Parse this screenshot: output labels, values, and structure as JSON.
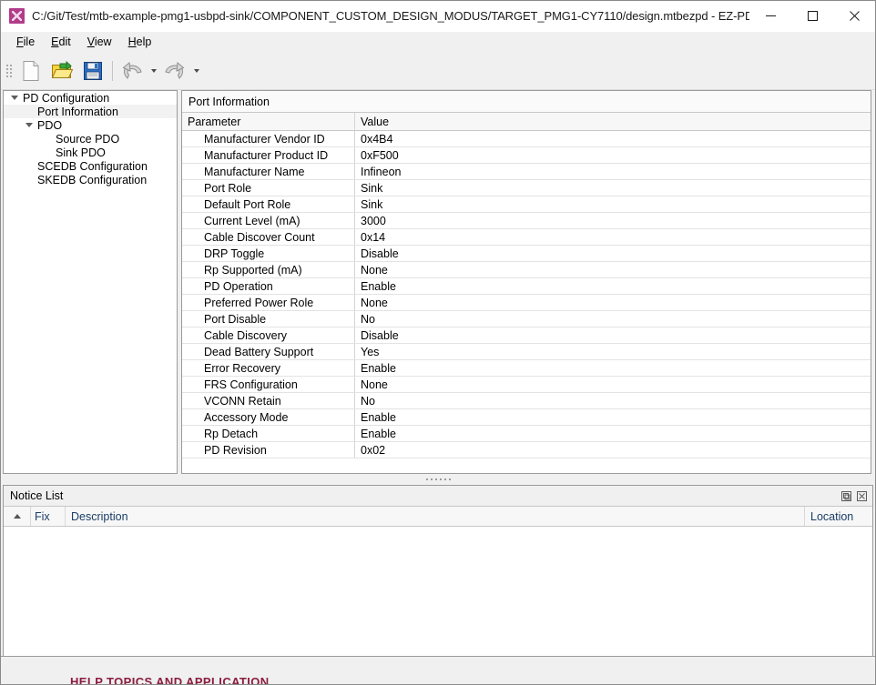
{
  "window": {
    "title": "C:/Git/Test/mtb-example-pmg1-usbpd-sink/COMPONENT_CUSTOM_DESIGN_MODUS/TARGET_PMG1-CY7110/design.mtbezpd - EZ-PD Configurato...",
    "app_icon": "ez-pd-configurator-icon",
    "controls": {
      "minimize": "minimize-icon",
      "maximize": "maximize-icon",
      "close": "close-icon"
    }
  },
  "menubar": {
    "items": [
      {
        "label": "File",
        "mnemonic": "F"
      },
      {
        "label": "Edit",
        "mnemonic": "E"
      },
      {
        "label": "View",
        "mnemonic": "V"
      },
      {
        "label": "Help",
        "mnemonic": "H"
      }
    ]
  },
  "toolbar": {
    "buttons": [
      {
        "name": "new-file-button",
        "icon": "new-file-icon"
      },
      {
        "name": "open-folder-button",
        "icon": "open-folder-icon"
      },
      {
        "name": "save-button",
        "icon": "save-floppy-icon"
      },
      {
        "name": "undo-button",
        "icon": "undo-arrow-icon"
      },
      {
        "name": "redo-button",
        "icon": "redo-arrow-icon"
      }
    ]
  },
  "tree": {
    "items": [
      {
        "label": "PD Configuration",
        "level": 0,
        "expander": "open",
        "selected": false
      },
      {
        "label": "Port Information",
        "level": 2,
        "expander": "none",
        "selected": true
      },
      {
        "label": "PDO",
        "level": 1,
        "expander": "open",
        "selected": false
      },
      {
        "label": "Source PDO",
        "level": 3,
        "expander": "none",
        "selected": false
      },
      {
        "label": "Sink PDO",
        "level": 3,
        "expander": "none",
        "selected": false
      },
      {
        "label": "SCEDB Configuration",
        "level": 2,
        "expander": "none",
        "selected": false
      },
      {
        "label": "SKEDB Configuration",
        "level": 2,
        "expander": "none",
        "selected": false
      }
    ]
  },
  "port_information": {
    "caption": "Port Information",
    "columns": [
      "Parameter",
      "Value"
    ],
    "rows": [
      {
        "parameter": "Manufacturer Vendor ID",
        "value": "0x4B4"
      },
      {
        "parameter": "Manufacturer Product ID",
        "value": "0xF500"
      },
      {
        "parameter": "Manufacturer Name",
        "value": "Infineon"
      },
      {
        "parameter": "Port Role",
        "value": "Sink"
      },
      {
        "parameter": "Default Port Role",
        "value": "Sink"
      },
      {
        "parameter": "Current Level (mA)",
        "value": "3000"
      },
      {
        "parameter": "Cable Discover Count",
        "value": "0x14"
      },
      {
        "parameter": "DRP Toggle",
        "value": "Disable"
      },
      {
        "parameter": "Rp Supported (mA)",
        "value": "None"
      },
      {
        "parameter": "PD Operation",
        "value": "Enable"
      },
      {
        "parameter": "Preferred Power Role",
        "value": "None"
      },
      {
        "parameter": "Port Disable",
        "value": "No"
      },
      {
        "parameter": "Cable Discovery",
        "value": "Disable"
      },
      {
        "parameter": "Dead Battery Support",
        "value": "Yes"
      },
      {
        "parameter": "Error Recovery",
        "value": "Enable"
      },
      {
        "parameter": "FRS Configuration",
        "value": "None"
      },
      {
        "parameter": "VCONN Retain",
        "value": "No"
      },
      {
        "parameter": "Accessory Mode",
        "value": "Enable"
      },
      {
        "parameter": "Rp Detach",
        "value": "Enable"
      },
      {
        "parameter": "PD Revision",
        "value": "0x02"
      }
    ]
  },
  "notice_list": {
    "title": "Notice List",
    "columns": {
      "fix": "Fix",
      "description": "Description",
      "location": "Location"
    },
    "buttons": {
      "float": "float-panel-icon",
      "close": "close-panel-icon"
    },
    "rows": []
  },
  "status_strip": {
    "clipped_text": "HELP TOPICS AND APPLICATION"
  }
}
